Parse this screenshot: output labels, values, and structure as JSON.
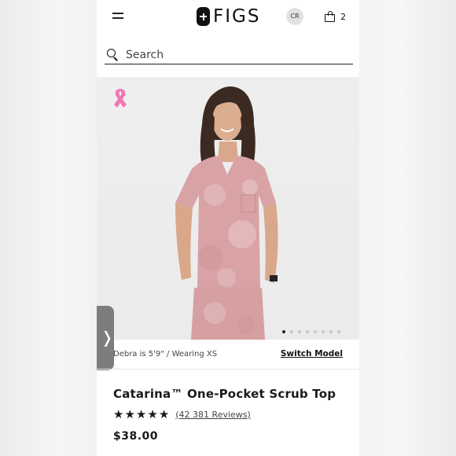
{
  "header": {
    "brand": "FIGS",
    "region": "CR",
    "cart_count": "2"
  },
  "search": {
    "placeholder": "Search"
  },
  "gallery": {
    "dots_total": 8,
    "active_index": 0
  },
  "model": {
    "caption": "Debra is 5'9\" / Wearing XS",
    "switch_label": "Switch Model"
  },
  "product": {
    "title": "Catarina™ One-Pocket Scrub Top",
    "rating": 4.5,
    "reviews_label": "(42 381 Reviews)",
    "price": "$38.00"
  },
  "colors": {
    "ribbon": "#f277b0",
    "scrub": "#d9a3a6",
    "hair": "#3a2a22",
    "skin": "#d9a88a"
  },
  "icons": {
    "menu": "hamburger-icon",
    "search": "search-icon",
    "bag": "shopping-bag-icon",
    "ribbon": "pink-ribbon-icon",
    "side_tab": "chevron-right-icon"
  }
}
